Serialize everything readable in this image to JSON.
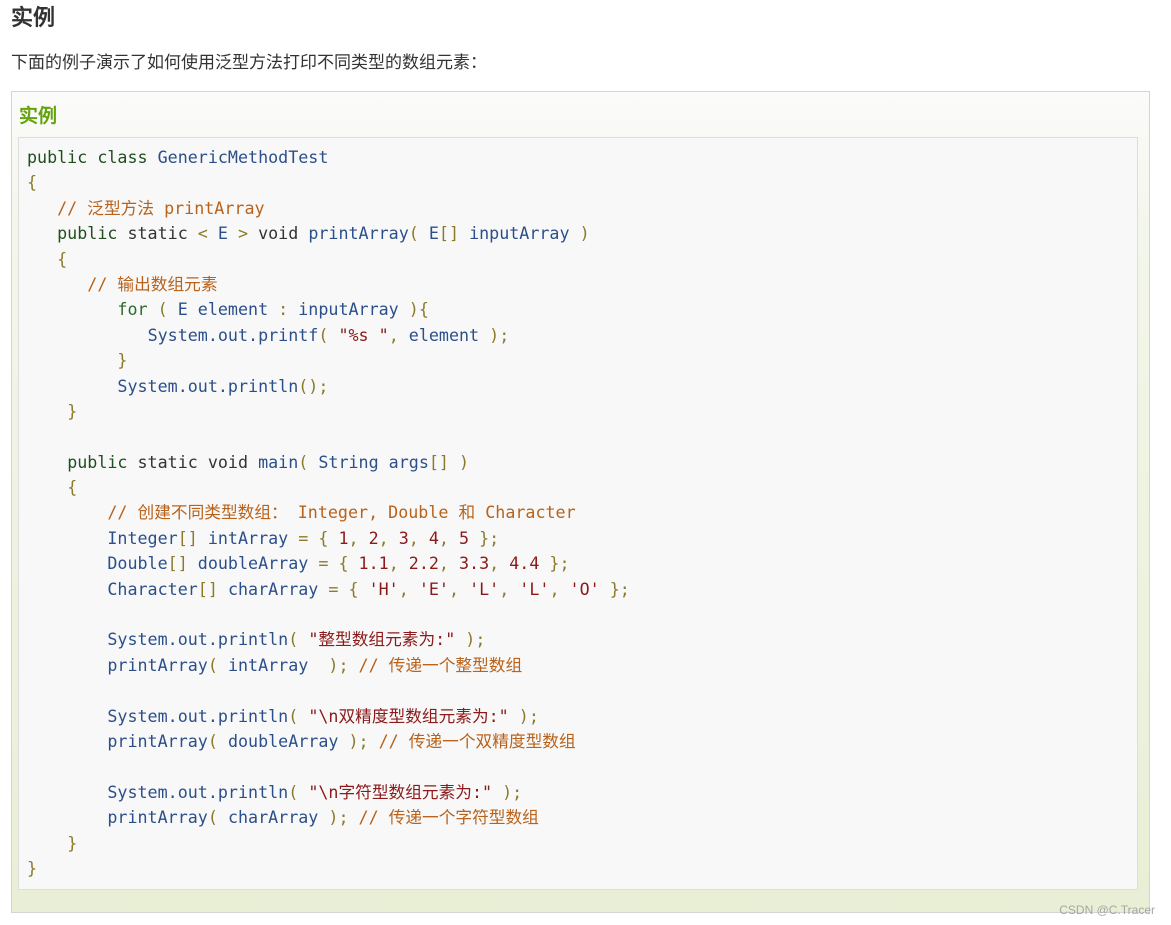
{
  "heading": "实例",
  "intro": "下面的例子演示了如何使用泛型方法打印不同类型的数组元素：",
  "example": {
    "title": "实例",
    "code_lines": [
      [
        [
          "kw",
          "public class "
        ],
        [
          "id",
          "GenericMethodTest"
        ]
      ],
      [
        [
          "pn",
          "{"
        ]
      ],
      [
        [
          "txt",
          "   "
        ],
        [
          "cm",
          "// 泛型方法 printArray"
        ]
      ],
      [
        [
          "txt",
          "   "
        ],
        [
          "kw",
          "public"
        ],
        [
          "txt",
          " static "
        ],
        [
          "pn",
          "< "
        ],
        [
          "id",
          "E"
        ],
        [
          "pn",
          " > "
        ],
        [
          "txt",
          "void "
        ],
        [
          "id",
          "printArray"
        ],
        [
          "pn",
          "( "
        ],
        [
          "id",
          "E"
        ],
        [
          "pn",
          "[] "
        ],
        [
          "id",
          "inputArray"
        ],
        [
          "pn",
          " )"
        ]
      ],
      [
        [
          "txt",
          "   "
        ],
        [
          "pn",
          "{"
        ]
      ],
      [
        [
          "txt",
          "      "
        ],
        [
          "cm",
          "// 输出数组元素"
        ]
      ],
      [
        [
          "txt",
          "         "
        ],
        [
          "kw2",
          "for"
        ],
        [
          "pn",
          " ( "
        ],
        [
          "id",
          "E element"
        ],
        [
          "pn",
          " : "
        ],
        [
          "id",
          "inputArray"
        ],
        [
          "pn",
          " ){"
        ]
      ],
      [
        [
          "txt",
          "            "
        ],
        [
          "id",
          "System.out.printf"
        ],
        [
          "pn",
          "( "
        ],
        [
          "str",
          "\"%s \""
        ],
        [
          "pn",
          ", "
        ],
        [
          "id",
          "element"
        ],
        [
          "pn",
          " );"
        ]
      ],
      [
        [
          "txt",
          "         "
        ],
        [
          "pn",
          "}"
        ]
      ],
      [
        [
          "txt",
          "         "
        ],
        [
          "id",
          "System.out.println"
        ],
        [
          "pn",
          "();"
        ]
      ],
      [
        [
          "txt",
          "    "
        ],
        [
          "pn",
          "}"
        ]
      ],
      [
        [
          "txt",
          ""
        ]
      ],
      [
        [
          "txt",
          "    "
        ],
        [
          "kw",
          "public"
        ],
        [
          "txt",
          " static void "
        ],
        [
          "id",
          "main"
        ],
        [
          "pn",
          "( "
        ],
        [
          "id",
          "String args"
        ],
        [
          "pn",
          "[] )"
        ]
      ],
      [
        [
          "txt",
          "    "
        ],
        [
          "pn",
          "{"
        ]
      ],
      [
        [
          "txt",
          "        "
        ],
        [
          "cm",
          "// 创建不同类型数组： Integer, Double 和 Character"
        ]
      ],
      [
        [
          "txt",
          "        "
        ],
        [
          "id",
          "Integer"
        ],
        [
          "pn",
          "[] "
        ],
        [
          "id",
          "intArray"
        ],
        [
          "pn",
          " = { "
        ],
        [
          "num",
          "1"
        ],
        [
          "pn",
          ", "
        ],
        [
          "num",
          "2"
        ],
        [
          "pn",
          ", "
        ],
        [
          "num",
          "3"
        ],
        [
          "pn",
          ", "
        ],
        [
          "num",
          "4"
        ],
        [
          "pn",
          ", "
        ],
        [
          "num",
          "5"
        ],
        [
          "pn",
          " };"
        ]
      ],
      [
        [
          "txt",
          "        "
        ],
        [
          "id",
          "Double"
        ],
        [
          "pn",
          "[] "
        ],
        [
          "id",
          "doubleArray"
        ],
        [
          "pn",
          " = { "
        ],
        [
          "num",
          "1.1"
        ],
        [
          "pn",
          ", "
        ],
        [
          "num",
          "2.2"
        ],
        [
          "pn",
          ", "
        ],
        [
          "num",
          "3.3"
        ],
        [
          "pn",
          ", "
        ],
        [
          "num",
          "4.4"
        ],
        [
          "pn",
          " };"
        ]
      ],
      [
        [
          "txt",
          "        "
        ],
        [
          "id",
          "Character"
        ],
        [
          "pn",
          "[] "
        ],
        [
          "id",
          "charArray"
        ],
        [
          "pn",
          " = { "
        ],
        [
          "str",
          "'H'"
        ],
        [
          "pn",
          ", "
        ],
        [
          "str",
          "'E'"
        ],
        [
          "pn",
          ", "
        ],
        [
          "str",
          "'L'"
        ],
        [
          "pn",
          ", "
        ],
        [
          "str",
          "'L'"
        ],
        [
          "pn",
          ", "
        ],
        [
          "str",
          "'O'"
        ],
        [
          "pn",
          " };"
        ]
      ],
      [
        [
          "txt",
          ""
        ]
      ],
      [
        [
          "txt",
          "        "
        ],
        [
          "id",
          "System.out.println"
        ],
        [
          "pn",
          "( "
        ],
        [
          "str",
          "\"整型数组元素为:\""
        ],
        [
          "pn",
          " );"
        ]
      ],
      [
        [
          "txt",
          "        "
        ],
        [
          "id",
          "printArray"
        ],
        [
          "pn",
          "( "
        ],
        [
          "id",
          "intArray"
        ],
        [
          "pn",
          "  ); "
        ],
        [
          "cm",
          "// 传递一个整型数组"
        ]
      ],
      [
        [
          "txt",
          ""
        ]
      ],
      [
        [
          "txt",
          "        "
        ],
        [
          "id",
          "System.out.println"
        ],
        [
          "pn",
          "( "
        ],
        [
          "str",
          "\"\\n双精度型数组元素为:\""
        ],
        [
          "pn",
          " );"
        ]
      ],
      [
        [
          "txt",
          "        "
        ],
        [
          "id",
          "printArray"
        ],
        [
          "pn",
          "( "
        ],
        [
          "id",
          "doubleArray"
        ],
        [
          "pn",
          " ); "
        ],
        [
          "cm",
          "// 传递一个双精度型数组"
        ]
      ],
      [
        [
          "txt",
          ""
        ]
      ],
      [
        [
          "txt",
          "        "
        ],
        [
          "id",
          "System.out.println"
        ],
        [
          "pn",
          "( "
        ],
        [
          "str",
          "\"\\n字符型数组元素为:\""
        ],
        [
          "pn",
          " );"
        ]
      ],
      [
        [
          "txt",
          "        "
        ],
        [
          "id",
          "printArray"
        ],
        [
          "pn",
          "( "
        ],
        [
          "id",
          "charArray"
        ],
        [
          "pn",
          " ); "
        ],
        [
          "cm",
          "// 传递一个字符型数组"
        ]
      ],
      [
        [
          "txt",
          "    "
        ],
        [
          "pn",
          "}"
        ]
      ],
      [
        [
          "pn",
          "}"
        ]
      ]
    ]
  },
  "watermark": "CSDN @C.Tracer"
}
